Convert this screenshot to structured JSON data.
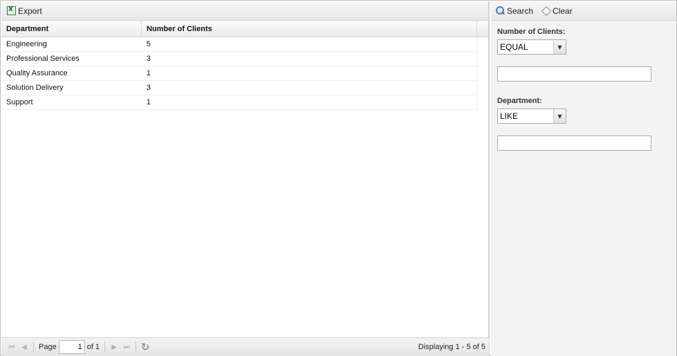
{
  "toolbar": {
    "export_label": "Export"
  },
  "grid": {
    "columns": [
      "Department",
      "Number of Clients"
    ],
    "rows": [
      {
        "department": "Engineering",
        "clients": "5"
      },
      {
        "department": "Professional Services",
        "clients": "3"
      },
      {
        "department": "Quality Assurance",
        "clients": "1"
      },
      {
        "department": "Solution Delivery",
        "clients": "3"
      },
      {
        "department": "Support",
        "clients": "1"
      }
    ]
  },
  "paging": {
    "page_label": "Page",
    "page_value": "1",
    "of_label": "of 1",
    "display_text": "Displaying 1 - 5 of 5"
  },
  "filter": {
    "search_label": "Search",
    "clear_label": "Clear",
    "fields": [
      {
        "label": "Number of Clients:",
        "operator": "EQUAL",
        "value": ""
      },
      {
        "label": "Department:",
        "operator": "LIKE",
        "value": ""
      }
    ]
  }
}
